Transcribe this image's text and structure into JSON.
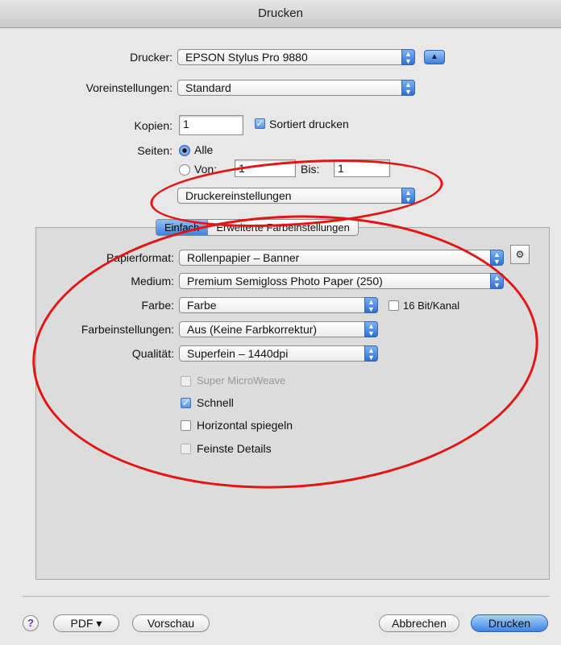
{
  "window": {
    "title": "Drucken"
  },
  "printer": {
    "label": "Drucker:",
    "value": "EPSON Stylus Pro 9880"
  },
  "presets": {
    "label": "Voreinstellungen:",
    "value": "Standard"
  },
  "copies": {
    "label": "Kopien:",
    "value": "1",
    "collate_label": "Sortiert drucken"
  },
  "pages": {
    "label": "Seiten:",
    "all_label": "Alle",
    "from_label": "Von:",
    "from_value": "1",
    "to_label": "Bis:",
    "to_value": "1"
  },
  "panel_select": {
    "value": "Druckereinstellungen"
  },
  "tabs": [
    {
      "label": "Einfach"
    },
    {
      "label": "Erweiterte Farbeinstellungen"
    }
  ],
  "settings": {
    "paper_format": {
      "label": "Papierformat:",
      "value": "Rollenpapier – Banner"
    },
    "medium": {
      "label": "Medium:",
      "value": "Premium Semigloss Photo Paper (250)"
    },
    "color": {
      "label": "Farbe:",
      "value": "Farbe",
      "bit16_label": "16 Bit/Kanal"
    },
    "color_settings": {
      "label": "Farbeinstellungen:",
      "value": "Aus (Keine Farbkorrektur)"
    },
    "quality": {
      "label": "Qualität:",
      "value": "Superfein – 1440dpi"
    },
    "super_microweave": {
      "label": "Super MicroWeave"
    },
    "fast": {
      "label": "Schnell"
    },
    "mirror": {
      "label": "Horizontal spiegeln"
    },
    "finest": {
      "label": "Feinste Details"
    }
  },
  "footer": {
    "help": "?",
    "pdf": "PDF ▾",
    "preview": "Vorschau",
    "cancel": "Abbrechen",
    "print": "Drucken"
  },
  "colors": {
    "annotation": "#e31414",
    "accent": "#3c82e0"
  }
}
